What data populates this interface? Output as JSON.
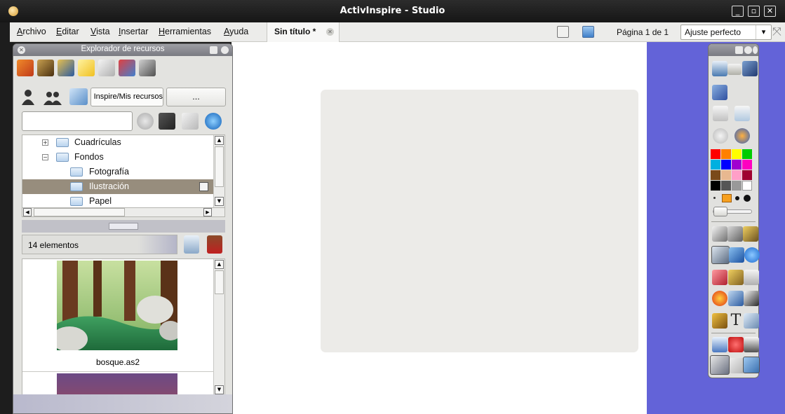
{
  "window": {
    "title": "ActivInspire - Studio"
  },
  "menu": {
    "items": [
      {
        "label": "Archivo",
        "u": "A",
        "rest": "rchivo"
      },
      {
        "label": "Editar",
        "u": "E",
        "rest": "ditar"
      },
      {
        "label": "Vista",
        "u": "V",
        "rest": "ista"
      },
      {
        "label": "Insertar",
        "u": "I",
        "rest": "nsertar"
      },
      {
        "label": "Herramientas",
        "u": "H",
        "rest": "erramientas"
      },
      {
        "label": "Ayuda",
        "u": "A",
        "rest": "yuda"
      }
    ],
    "document_tab": "Sin título *",
    "page_indicator": "Página 1 de 1",
    "zoom": "Ajuste perfecto"
  },
  "resource_browser": {
    "title": "Explorador de recursos",
    "path": "Inspire/Mis recursos",
    "more_button": "...",
    "search_placeholder": "",
    "tree": [
      {
        "label": "Cuadrículas",
        "level": 1,
        "expander": "+"
      },
      {
        "label": "Fondos",
        "level": 1,
        "expander": "-"
      },
      {
        "label": "Fotografía",
        "level": 2
      },
      {
        "label": "Ilustración",
        "level": 2,
        "selected": true
      },
      {
        "label": "Papel",
        "level": 2
      }
    ],
    "count_label": "14 elementos",
    "items": [
      {
        "name": "bosque.as2"
      }
    ]
  },
  "colors": {
    "accent_canvas_bg": "#6363d8",
    "selection": "#978d7d",
    "palette": [
      "#ff0000",
      "#ff8000",
      "#ffff00",
      "#00cc00",
      "#00b0e0",
      "#0000ff",
      "#a000d0",
      "#ff00c0",
      "#7a4a1a",
      "#e8b890",
      "#ff9fc8",
      "#a00030",
      "#000000",
      "#555555",
      "#999999",
      "#ffffff"
    ]
  }
}
